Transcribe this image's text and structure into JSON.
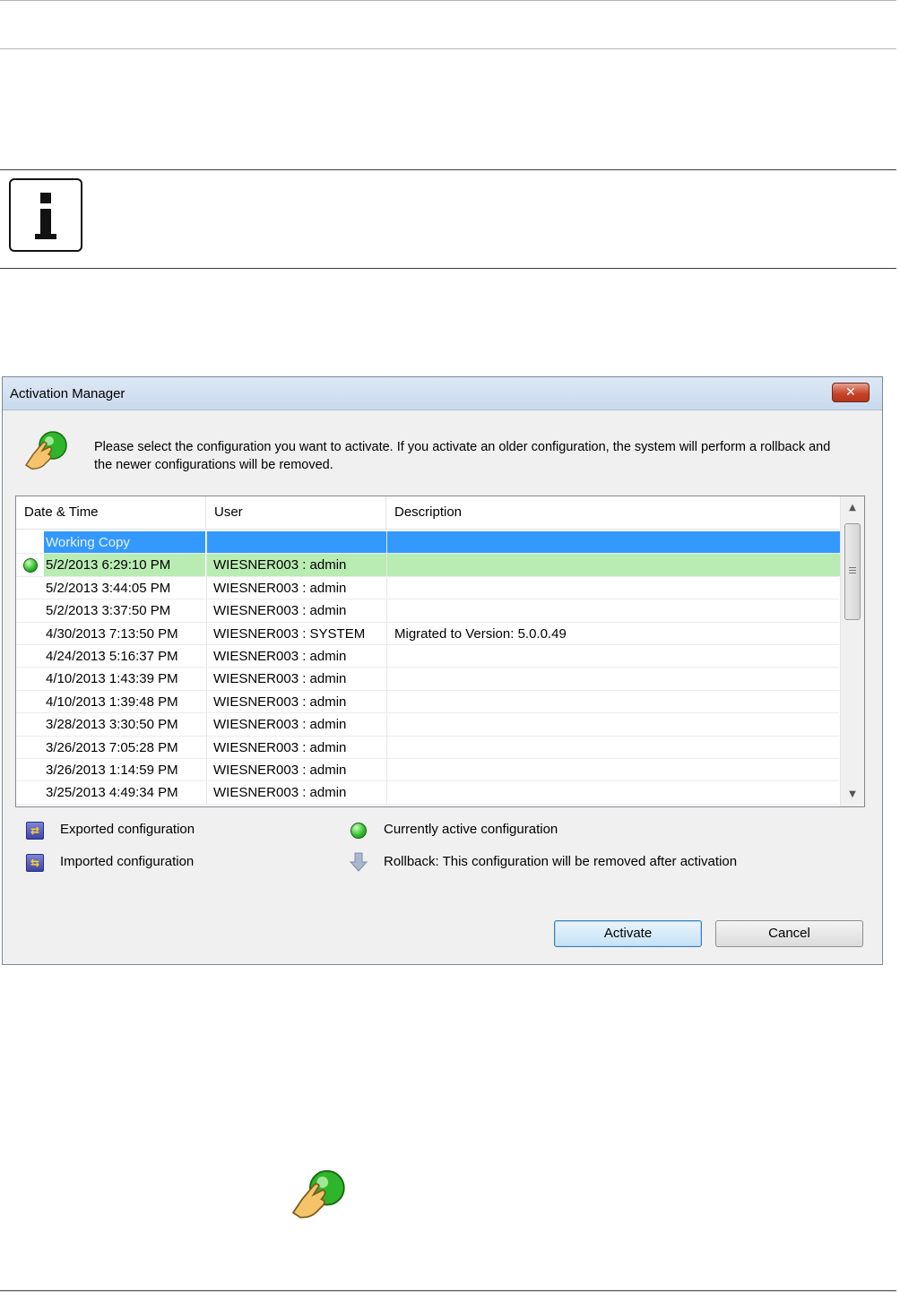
{
  "dialog": {
    "title": "Activation Manager",
    "close_label": "✕",
    "instruction": "Please select the configuration you want to activate. If you activate an older configuration, the system will perform a rollback and the newer configurations will be removed."
  },
  "table": {
    "columns": [
      "Date & Time",
      "User",
      "Description"
    ],
    "rows": [
      {
        "datetime": "Working Copy",
        "user": "",
        "description": "",
        "state": "selected"
      },
      {
        "datetime": "5/2/2013 6:29:10 PM",
        "user": "WIESNER003 : admin",
        "description": "",
        "state": "active"
      },
      {
        "datetime": "5/2/2013 3:44:05 PM",
        "user": "WIESNER003 : admin",
        "description": ""
      },
      {
        "datetime": "5/2/2013 3:37:50 PM",
        "user": "WIESNER003 : admin",
        "description": ""
      },
      {
        "datetime": "4/30/2013 7:13:50 PM",
        "user": "WIESNER003 : SYSTEM",
        "description": "Migrated to Version: 5.0.0.49"
      },
      {
        "datetime": "4/24/2013 5:16:37 PM",
        "user": "WIESNER003 : admin",
        "description": ""
      },
      {
        "datetime": "4/10/2013 1:43:39 PM",
        "user": "WIESNER003 : admin",
        "description": ""
      },
      {
        "datetime": "4/10/2013 1:39:48 PM",
        "user": "WIESNER003 : admin",
        "description": ""
      },
      {
        "datetime": "3/28/2013 3:30:50 PM",
        "user": "WIESNER003 : admin",
        "description": ""
      },
      {
        "datetime": "3/26/2013 7:05:28 PM",
        "user": "WIESNER003 : admin",
        "description": ""
      },
      {
        "datetime": "3/26/2013 1:14:59 PM",
        "user": "WIESNER003 : admin",
        "description": ""
      },
      {
        "datetime": "3/25/2013 4:49:34 PM",
        "user": "WIESNER003 : admin",
        "description": ""
      }
    ]
  },
  "legend": {
    "exported": "Exported configuration",
    "imported": "Imported configuration",
    "active": "Currently active configuration",
    "rollback": "Rollback: This configuration will be removed after activation"
  },
  "buttons": {
    "activate": "Activate",
    "cancel": "Cancel"
  },
  "icons": {
    "notice": "info-icon",
    "hand": "activate-hand-icon",
    "exported": "export-config-icon",
    "imported": "import-config-icon",
    "active": "green-dot-icon",
    "rollback": "down-arrow-icon"
  },
  "colors": {
    "selected_row": "#3399ff",
    "active_row": "#b9ecb3",
    "active_dot": "#32c02c"
  }
}
